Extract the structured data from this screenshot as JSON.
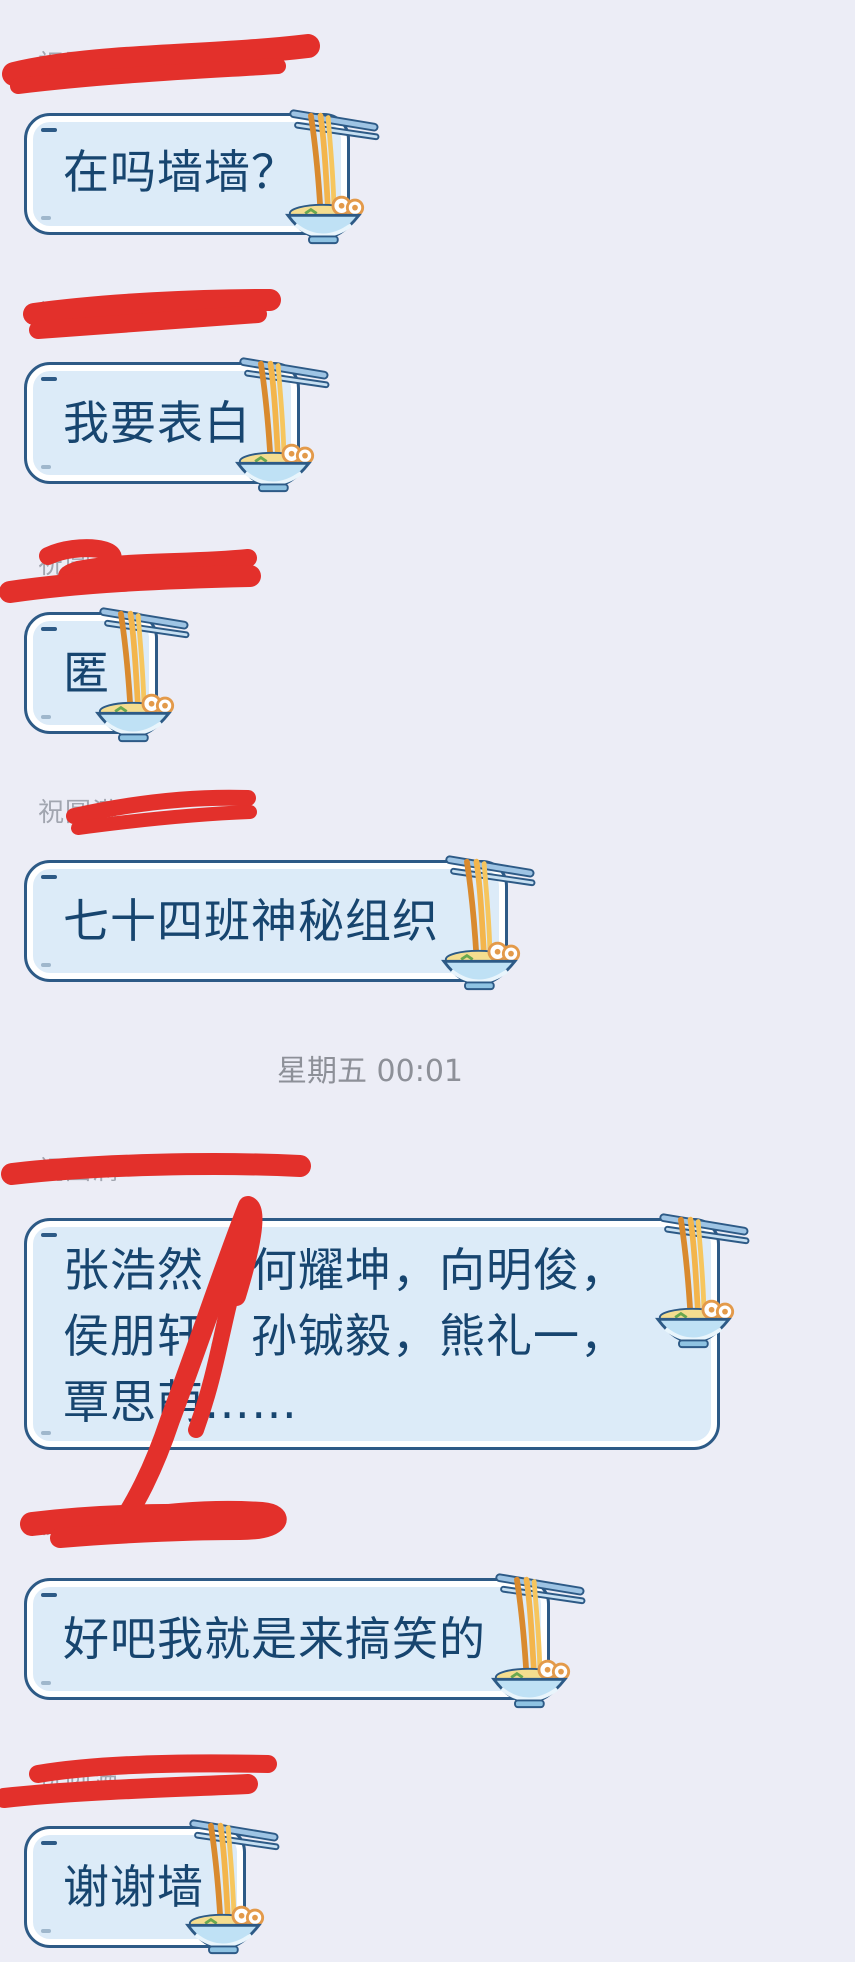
{
  "chat": {
    "timestamp": "星期五 00:01",
    "messages": [
      {
        "sender": "祝圆满",
        "text": "在吗墙墙？"
      },
      {
        "sender": "祝圆满",
        "text": "我要表白"
      },
      {
        "sender": "祝圆满",
        "text": "匿"
      },
      {
        "sender": "祝圆满",
        "text": "七十四班神秘组织"
      },
      {
        "sender": "祝圆满",
        "text": "张浩然，何耀坤，向明俊，\n侯朋轩，孙铖毅，熊礼一，\n覃思萌……"
      },
      {
        "sender": "祝圆满",
        "text": "好吧我就是来搞笑的"
      },
      {
        "sender": "祝圆满",
        "text": "谢谢墙"
      }
    ]
  },
  "colors": {
    "background": "#ecedf6",
    "bubble_fill": "#dcebf8",
    "bubble_border": "#2d5a86",
    "bubble_text": "#17456f",
    "redaction": "#e3302b",
    "timestamp": "#8d9098"
  },
  "icons": {
    "bubble_decoration": "noodle-bowl-icon"
  }
}
